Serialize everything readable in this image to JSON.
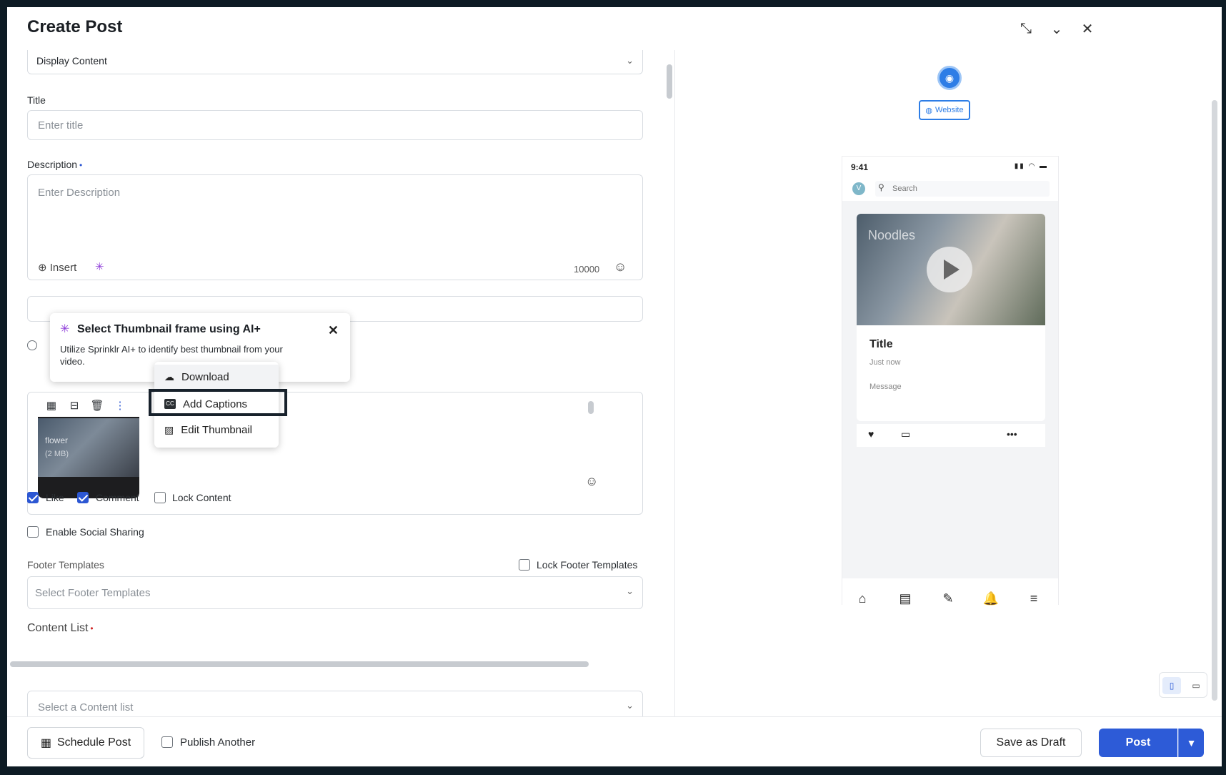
{
  "header": {
    "title": "Create Post",
    "collapse_icon": "collapse-arrows-icon",
    "chevron_icon": "chevron-down-icon",
    "close_icon": "close-icon"
  },
  "form": {
    "content_type": {
      "value": "Display Content"
    },
    "title": {
      "label": "Title",
      "placeholder": "Enter title"
    },
    "description": {
      "label": "Description",
      "placeholder": "Enter Description",
      "insert_label": "Insert",
      "char_count": "10000"
    },
    "popover": {
      "title": "Select Thumbnail frame using AI+",
      "text": "Utilize Sprinklr AI+ to identify best thumbnail from your video."
    },
    "media": {
      "file_name": "flower",
      "file_size": "(2 MB)",
      "menu": [
        "Download",
        "Add Captions",
        "Edit Thumbnail"
      ]
    },
    "checkboxes": {
      "like": {
        "label": "Like",
        "checked": true
      },
      "comment": {
        "label": "Comment",
        "checked": true
      },
      "lock_content": {
        "label": "Lock Content",
        "checked": false
      },
      "social_sharing": {
        "label": "Enable Social Sharing",
        "checked": false
      },
      "lock_footer": {
        "label": "Lock Footer Templates",
        "checked": false
      }
    },
    "footer_templates": {
      "label": "Footer Templates",
      "placeholder": "Select Footer Templates"
    },
    "content_list": {
      "label": "Content List",
      "placeholder": "Select a Content list"
    }
  },
  "footer": {
    "schedule": "Schedule Post",
    "publish_another": "Publish Another",
    "save_draft": "Save as Draft",
    "post": "Post"
  },
  "preview": {
    "channel_chip": "Website",
    "time": "9:41",
    "search_placeholder": "Search",
    "avatar_letter": "V",
    "card_overlay": "Noodles",
    "card_title": "Title",
    "card_time": "Just now",
    "card_message": "Message"
  },
  "colors": {
    "primary": "#2d5bd7",
    "accent_purple": "#8e3dd9",
    "highlight_border": "#17212b"
  }
}
